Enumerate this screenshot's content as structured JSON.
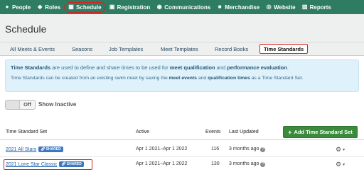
{
  "nav": {
    "items": [
      {
        "label": "People",
        "icon": "person-icon",
        "glyph": "●"
      },
      {
        "label": "Roles",
        "icon": "roles-icon",
        "glyph": "◆"
      },
      {
        "label": "Schedule",
        "icon": "calendar-icon",
        "glyph": "▦"
      },
      {
        "label": "Registration",
        "icon": "registration-icon",
        "glyph": "▣"
      },
      {
        "label": "Communications",
        "icon": "communications-icon",
        "glyph": "◉"
      },
      {
        "label": "Merchandise",
        "icon": "merchandise-icon",
        "glyph": "■"
      },
      {
        "label": "Website",
        "icon": "globe-icon",
        "glyph": "◎"
      },
      {
        "label": "Reports",
        "icon": "reports-icon",
        "glyph": "▥"
      }
    ],
    "active": "Schedule"
  },
  "page": {
    "title": "Schedule"
  },
  "tabs": [
    {
      "label": "All Meets & Events"
    },
    {
      "label": "Seasons"
    },
    {
      "label": "Job Templates"
    },
    {
      "label": "Meet Templates"
    },
    {
      "label": "Record Books"
    },
    {
      "label": "Time Standards"
    }
  ],
  "info": {
    "line1_a": "Time Standards",
    "line1_b": " are used to define and share times to be used for ",
    "line1_c": "meet qualification",
    "line1_d": " and ",
    "line1_e": "performance evaluation",
    "line1_f": ".",
    "line2_a": "Time Standards can be created from an existing swim meet by saving the ",
    "line2_b": "meet events",
    "line2_c": " and ",
    "line2_d": "qualification times",
    "line2_e": " as a Time Standard Set."
  },
  "toggle": {
    "state": "Off",
    "label": "Show Inactive"
  },
  "table": {
    "headers": {
      "set": "Time Standard Set",
      "active": "Active",
      "events": "Events",
      "updated": "Last Updated"
    },
    "add_button": "Add Time Standard Set",
    "rows": [
      {
        "name": "2021 All Stars",
        "badge": "SHARED",
        "active": "Apr 1 2021–Apr 1 2022",
        "events": "116",
        "updated": "3 months ago"
      },
      {
        "name": "2021 Lone Star Classic",
        "badge": "SHARED",
        "active": "Apr 1 2021–Apr 1 2022",
        "events": "130",
        "updated": "3 months ago"
      }
    ]
  },
  "colors": {
    "nav_bg": "#2e7d63",
    "highlight": "#d9231f",
    "add_button": "#3c8a3c",
    "info_bg": "#dff1fa"
  }
}
